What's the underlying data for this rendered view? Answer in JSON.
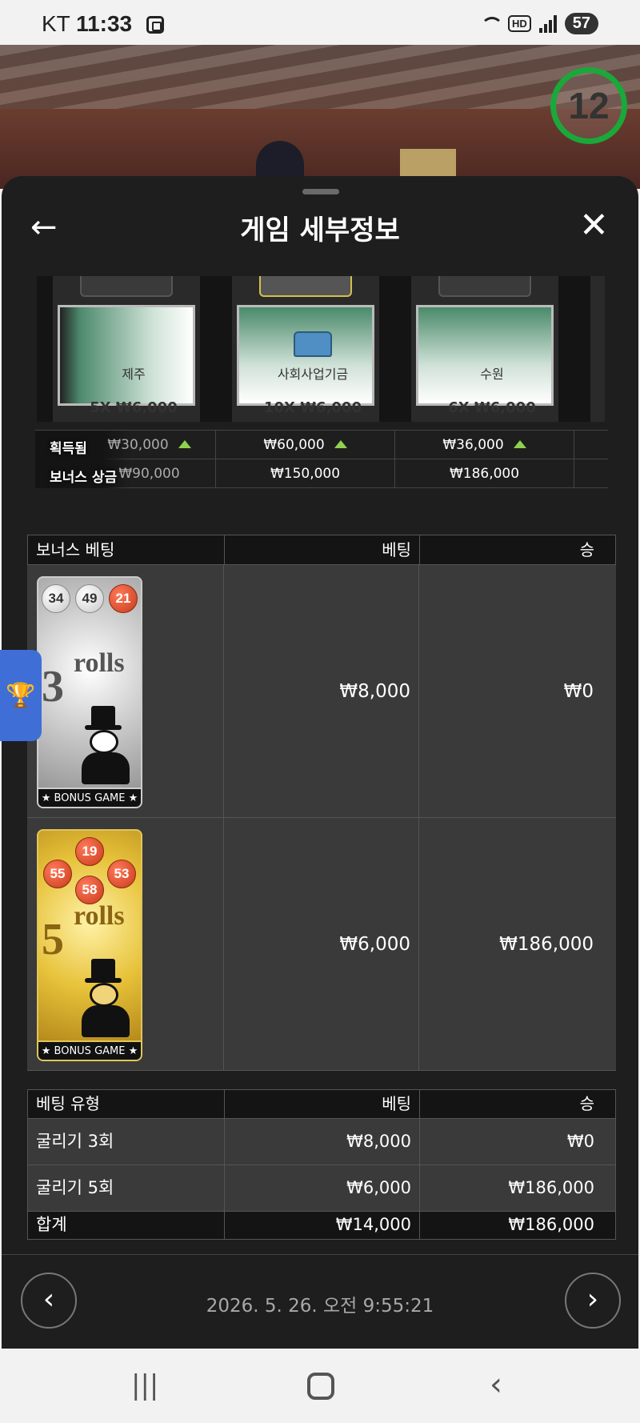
{
  "status_bar": {
    "carrier": "KT",
    "time": "11:33",
    "battery": "57"
  },
  "game_timer": "12",
  "sheet": {
    "title": "게임 세부정보"
  },
  "cards": [
    {
      "name": "",
      "multiplier": ""
    },
    {
      "name": "제주",
      "multiplier": "5X ₩6,000"
    },
    {
      "name": "사회사업기금",
      "multiplier": "10X ₩6,000"
    },
    {
      "name": "수원",
      "multiplier": "6X ₩6,000"
    }
  ],
  "summary": {
    "won_label": "획득됨",
    "bonus_label": "보너스 상금",
    "won": [
      "₩30,000",
      "₩60,000",
      "₩36,000"
    ],
    "bonus": [
      "₩90,000",
      "₩150,000",
      "₩186,000"
    ]
  },
  "bonus_table": {
    "headers": [
      "보너스 베팅",
      "베팅",
      "승"
    ],
    "rows": [
      {
        "rolls": "3",
        "rolls_text": "rolls",
        "balls": [
          "34",
          "49",
          "21"
        ],
        "card_label": "★ BONUS GAME ★",
        "bet": "₩8,000",
        "win": "₩0"
      },
      {
        "rolls": "5",
        "rolls_text": "rolls",
        "balls": [
          "19",
          "55",
          "53",
          "58"
        ],
        "card_label": "★ BONUS GAME ★",
        "bet": "₩6,000",
        "win": "₩186,000"
      }
    ]
  },
  "type_table": {
    "headers": [
      "베팅 유형",
      "베팅",
      "승"
    ],
    "rows": [
      {
        "type": "굴리기 3회",
        "bet": "₩8,000",
        "win": "₩0"
      },
      {
        "type": "굴리기 5회",
        "bet": "₩6,000",
        "win": "₩186,000"
      }
    ],
    "total": {
      "label": "합계",
      "bet": "₩14,000",
      "win": "₩186,000"
    }
  },
  "footer": {
    "datetime": "2026. 5. 26. 오전 9:55:21"
  },
  "colors": {
    "timer_ring": "#1aa83b",
    "up_arrow": "#8fd14f",
    "side_tab": "#3f6fd6"
  },
  "icons": {
    "back": "arrow-left-icon",
    "close": "close-icon",
    "prev": "chevron-left-icon",
    "next": "chevron-right-icon",
    "trophy": "trophy-icon"
  }
}
